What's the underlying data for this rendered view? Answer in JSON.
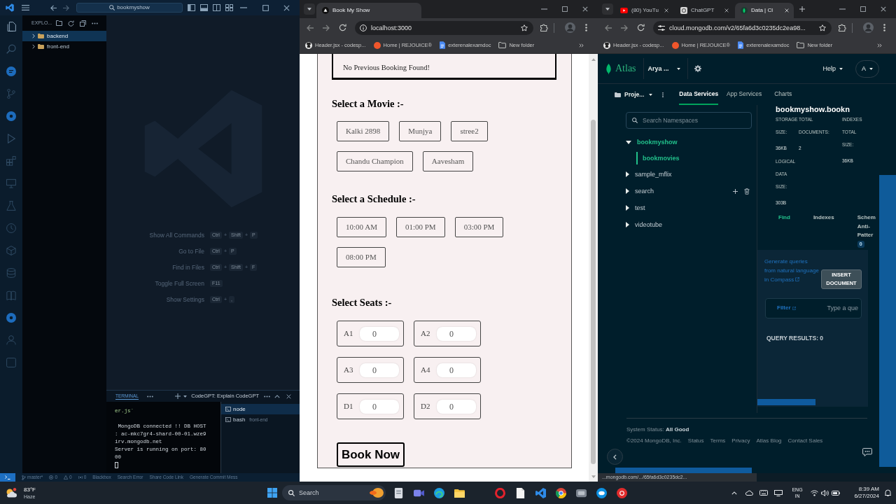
{
  "code_editor": {
    "command_center": "bookmyshow",
    "explorer": {
      "title": "EXPLO...",
      "items": [
        {
          "label": "backend",
          "selected": true
        },
        {
          "label": "front-end",
          "selected": false
        }
      ]
    },
    "shortcuts": [
      {
        "label": "Show All Commands",
        "keys": [
          {
            "kind": "key",
            "text": "Ctrl"
          },
          {
            "kind": "plus",
            "text": "+"
          },
          {
            "kind": "key",
            "text": "Shift"
          },
          {
            "kind": "plus",
            "text": "+"
          },
          {
            "kind": "key",
            "text": "P"
          }
        ]
      },
      {
        "label": "Go to File",
        "keys": [
          {
            "kind": "key",
            "text": "Ctrl"
          },
          {
            "kind": "plus",
            "text": "+"
          },
          {
            "kind": "key",
            "text": "P"
          }
        ]
      },
      {
        "label": "Find in Files",
        "keys": [
          {
            "kind": "key",
            "text": "Ctrl"
          },
          {
            "kind": "plus",
            "text": "+"
          },
          {
            "kind": "key",
            "text": "Shift"
          },
          {
            "kind": "plus",
            "text": "+"
          },
          {
            "kind": "key",
            "text": "F"
          }
        ]
      },
      {
        "label": "Toggle Full Screen",
        "keys": [
          {
            "kind": "key",
            "text": "F11"
          }
        ]
      },
      {
        "label": "Show Settings",
        "keys": [
          {
            "kind": "key",
            "text": "Ctrl"
          },
          {
            "kind": "plus",
            "text": "+"
          },
          {
            "kind": "key",
            "text": ","
          }
        ]
      }
    ],
    "panel": {
      "tabs": [
        {
          "label": "TERMINAL",
          "selected": true
        }
      ],
      "title": "CodeGPT: Explain CodeGPT",
      "terminal_output": [
        {
          "kind": "command",
          "lines": [
            "er.js`"
          ]
        },
        {
          "kind": "output",
          "lines": [
            " MongoDB connected !! DB HOST",
            ": ac-mkc7gr4-shard-00-01.wze9",
            "irv.mongodb.net",
            "Server is running on port: 80",
            "00"
          ]
        }
      ],
      "terminals": [
        {
          "label": "node",
          "selected": true
        },
        {
          "label": "bash",
          "detail": "front-end",
          "selected": false
        }
      ]
    },
    "status_bar": [
      {
        "kind": "branch",
        "text": "master*"
      },
      {
        "kind": "errors",
        "text": "0"
      },
      {
        "kind": "warnings",
        "text": "0"
      },
      {
        "kind": "ports",
        "text": "0"
      },
      {
        "kind": "text",
        "text": "Blackbox"
      },
      {
        "kind": "text",
        "text": "Search Error"
      },
      {
        "kind": "text",
        "text": "Share Code Link"
      },
      {
        "kind": "text",
        "text": "Generate Commit Mess"
      }
    ]
  },
  "browser_left": {
    "tabs": [
      {
        "kind": "app",
        "title": "Book My Show",
        "selected": true
      }
    ],
    "address": "localhost:3000",
    "bookmarks": [
      {
        "kind": "repository",
        "label": "Header.jsx - codesp..."
      },
      {
        "kind": "site",
        "label": "Home | REJOUICE®"
      },
      {
        "kind": "document",
        "label": "exterenalexamdoc"
      },
      {
        "kind": "folder",
        "label": "New folder"
      }
    ],
    "page": {
      "notice": "No Previous Booking Found!",
      "sections": [
        {
          "kind": "options",
          "heading": "Select a Movie :-",
          "options": [
            {
              "label": "Kalki 2898",
              "selected": false
            },
            {
              "label": "Munjya",
              "selected": false
            },
            {
              "label": "stree2",
              "selected": false
            },
            {
              "label": "Chandu Champion",
              "selected": false
            },
            {
              "label": "Aavesham",
              "selected": false
            }
          ]
        },
        {
          "kind": "options",
          "heading": "Select a Schedule :-",
          "options": [
            {
              "label": "10:00 AM",
              "selected": false
            },
            {
              "label": "01:00 PM",
              "selected": false
            },
            {
              "label": "03:00 PM",
              "selected": false
            },
            {
              "label": "08:00 PM",
              "selected": false
            }
          ]
        },
        {
          "kind": "seats",
          "heading": "Select Seats :-",
          "seats": [
            {
              "label": "A1",
              "value": "0"
            },
            {
              "label": "A2",
              "value": "0"
            },
            {
              "label": "A3",
              "value": "0"
            },
            {
              "label": "A4",
              "value": "0"
            },
            {
              "label": "D1",
              "value": "0"
            },
            {
              "label": "D2",
              "value": "0"
            }
          ]
        }
      ],
      "submit": "Book Now"
    }
  },
  "browser_right": {
    "tabs": [
      {
        "kind": "video",
        "title": "(80) YouTu",
        "selected": false
      },
      {
        "kind": "chat",
        "title": "ChatGPT",
        "selected": false
      },
      {
        "kind": "database",
        "title": "Data | Cl",
        "selected": true
      }
    ],
    "address": "cloud.mongodb.com/v2/65fa6d3c0235dc2ea98...",
    "bookmarks": [
      {
        "kind": "repository",
        "label": "Header.jsx - codesp..."
      },
      {
        "kind": "site",
        "label": "Home | REJOUICE®"
      },
      {
        "kind": "document",
        "label": "exterenalexamdoc"
      },
      {
        "kind": "folder",
        "label": "New folder"
      }
    ],
    "atlas": {
      "brand": "Atlas",
      "organization": "Arya ...",
      "help": "Help",
      "avatar": "A",
      "project": "Proje...",
      "nav": [
        {
          "label": "Data Services",
          "selected": true
        },
        {
          "label": "App Services",
          "selected": false
        },
        {
          "label": "Charts",
          "selected": false
        }
      ],
      "search": {
        "placeholder": "Search Namespaces"
      },
      "databases": [
        {
          "label": "bookmyshow",
          "expanded": true,
          "hovered": false,
          "children": [
            {
              "label": "bookmovies",
              "selected": true
            }
          ]
        },
        {
          "label": "sample_mflix",
          "expanded": false,
          "hovered": false
        },
        {
          "label": "search",
          "expanded": false,
          "hovered": true
        },
        {
          "label": "test",
          "expanded": false,
          "hovered": false
        },
        {
          "label": "videotube",
          "expanded": false,
          "hovered": false
        }
      ],
      "collection": {
        "title": "bookmyshow.bookn",
        "stat_columns": [
          [
            {
              "label": "STORAGE SIZE:",
              "value": "36KB"
            },
            {
              "label": "LOGICAL DATA SIZE:",
              "value": "303B"
            }
          ],
          [
            {
              "label": "TOTAL DOCUMENTS:",
              "value": "2"
            }
          ],
          [
            {
              "label": "INDEXES TOTAL SIZE:",
              "value": "36KB"
            }
          ]
        ],
        "tabs": [
          {
            "label": "Find",
            "selected": true
          },
          {
            "label": "Indexes",
            "selected": false
          },
          {
            "label": "Schem Anti-Patter",
            "badge": "0",
            "selected": false
          }
        ],
        "compass_link": "Generate queries from natural language in Compass",
        "insert_button": "INSERT DOCUMENT",
        "filter": {
          "label": "Filter",
          "placeholder": "Type a que"
        },
        "results": "QUERY RESULTS: 0"
      },
      "footer": {
        "status": "System Status: **All Good**",
        "copyright": "©2024 MongoDB, Inc.",
        "links": [
          "Status",
          "Terms",
          "Privacy",
          "Atlas Blog",
          "Contact Sales"
        ]
      }
    },
    "status_url": "...mongodb.com/.../65fa6d3c0235dc2..."
  },
  "taskbar": {
    "weather": {
      "temperature": "83°F",
      "condition": "Haze"
    },
    "search": {
      "placeholder": "Search"
    },
    "language": {
      "top": "ENG",
      "bottom": "IN"
    },
    "time": "8:39 AM",
    "date": "6/27/2024"
  }
}
